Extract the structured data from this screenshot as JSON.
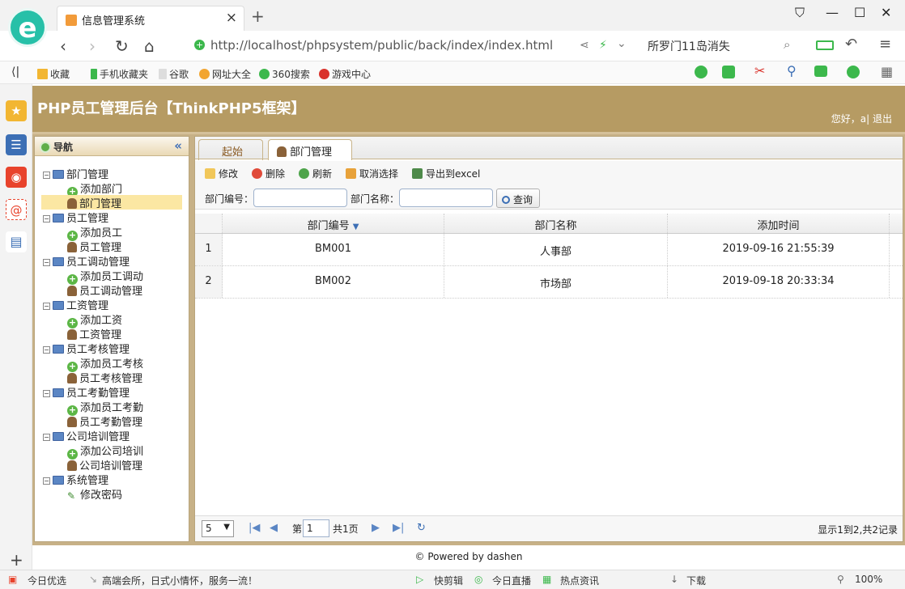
{
  "browser": {
    "tab_title": "信息管理系统",
    "url": "http://localhost/phpsystem/public/back/index/index.html",
    "search_text": "所罗门11岛消失",
    "bookmarks": [
      "收藏",
      "手机收藏夹",
      "谷歌",
      "网址大全",
      "360搜索",
      "游戏中心"
    ]
  },
  "app": {
    "title": "PHP员工管理后台【ThinkPHP5框架】",
    "greeting": "您好，a| 退出",
    "footer": "© Powered by dashen"
  },
  "nav": {
    "title": "导航",
    "collapse_icon": "«",
    "tree": [
      {
        "label": "部门管理",
        "children": [
          {
            "label": "添加部门",
            "icon": "add"
          },
          {
            "label": "部门管理",
            "icon": "user",
            "selected": true
          }
        ]
      },
      {
        "label": "员工管理",
        "children": [
          {
            "label": "添加员工",
            "icon": "add"
          },
          {
            "label": "员工管理",
            "icon": "user"
          }
        ]
      },
      {
        "label": "员工调动管理",
        "children": [
          {
            "label": "添加员工调动",
            "icon": "add"
          },
          {
            "label": "员工调动管理",
            "icon": "user"
          }
        ]
      },
      {
        "label": "工资管理",
        "children": [
          {
            "label": "添加工资",
            "icon": "add"
          },
          {
            "label": "工资管理",
            "icon": "user"
          }
        ]
      },
      {
        "label": "员工考核管理",
        "children": [
          {
            "label": "添加员工考核",
            "icon": "add"
          },
          {
            "label": "员工考核管理",
            "icon": "user"
          }
        ]
      },
      {
        "label": "员工考勤管理",
        "children": [
          {
            "label": "添加员工考勤",
            "icon": "add"
          },
          {
            "label": "员工考勤管理",
            "icon": "user"
          }
        ]
      },
      {
        "label": "公司培训管理",
        "children": [
          {
            "label": "添加公司培训",
            "icon": "add"
          },
          {
            "label": "公司培训管理",
            "icon": "user"
          }
        ]
      },
      {
        "label": "系统管理",
        "children": [
          {
            "label": "修改密码",
            "icon": "pen"
          }
        ]
      }
    ]
  },
  "tabs": {
    "home": "起始页",
    "dept": "部门管理",
    "close": "×"
  },
  "toolbar": {
    "edit": "修改",
    "delete": "删除",
    "refresh": "刷新",
    "cancel_select": "取消选择",
    "export": "导出到excel",
    "dept_no_label": "部门编号：",
    "dept_name_label": "部门名称：",
    "query": "查询",
    "dept_no_value": "",
    "dept_name_value": ""
  },
  "grid": {
    "columns": [
      "部门编号",
      "部门名称",
      "添加时间"
    ],
    "rows": [
      {
        "num": "1",
        "code": "BM001",
        "name": "人事部",
        "time": "2019-09-16 21:55:39"
      },
      {
        "num": "2",
        "code": "BM002",
        "name": "市场部",
        "time": "2019-09-18 20:33:34"
      }
    ]
  },
  "pager": {
    "page_size": "5",
    "page_prefix": "第",
    "page_value": "1",
    "page_total": "共1页",
    "info": "显示1到2,共2记录"
  },
  "status": {
    "left_label": "今日优选",
    "ad": "高端会所，日式小情怀，服务一流！",
    "items": [
      "快剪辑",
      "今日直播",
      "热点资讯",
      "下载"
    ],
    "zoom": "100%"
  }
}
